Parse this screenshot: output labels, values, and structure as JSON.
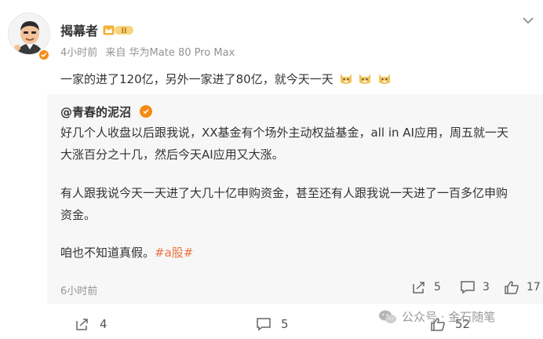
{
  "post": {
    "author": "揭幕者",
    "level_badge": "II",
    "time": "4小时前",
    "source": "来自 华为Mate 80 Pro Max",
    "text": "一家的进了120亿，另外一家进了80亿，就今天一天"
  },
  "repost": {
    "author": "@青春的泥沼",
    "line1": "好几个人收盘以后跟我说，XX基金有个场外主动权益基金，all in AI应用，周五就一天",
    "line2": "大涨百分之十几，然后今天AI应用又大涨。",
    "line3": "有人跟我说今天一天进了大几十亿申购资金，甚至还有人跟我说一天进了一百多亿申购",
    "line4": "资金。",
    "line5": "咱也不知道真假。",
    "hashtag": "#a股#",
    "time": "6小时前",
    "actions": {
      "repost_count": "5",
      "comment_count": "3",
      "like_count": "17"
    }
  },
  "toolbar": {
    "repost_count": "4",
    "comment_count": "5",
    "like_count": "52"
  },
  "watermark": {
    "text": "公众号 · 金石随笔"
  },
  "colors": {
    "accent": "#eb7340",
    "verified": "#f78a12",
    "meta": "#939393",
    "repost_bg": "#f7f7f7"
  },
  "icons": {
    "menu": "chevron-down-icon",
    "verified": "verified-badge-icon",
    "repost": "repost-icon",
    "comment": "comment-icon",
    "like": "thumbs-up-icon",
    "emoji": "doge-emoji-icon"
  }
}
